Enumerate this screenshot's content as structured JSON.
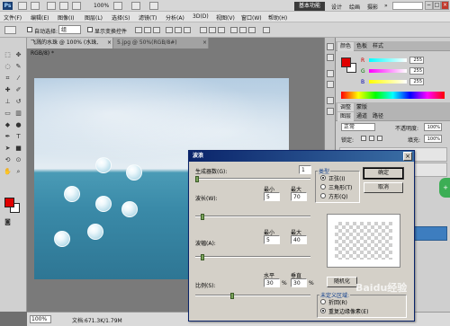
{
  "app": {
    "logo": "Ps",
    "zoom_level": "100%",
    "workspace_active": "基本功能",
    "workspaces": [
      "设计",
      "绘画",
      "摄影"
    ],
    "window_buttons": [
      "−",
      "□",
      "×"
    ]
  },
  "menu": [
    "文件(F)",
    "编辑(E)",
    "图像(I)",
    "图层(L)",
    "选择(S)",
    "滤镜(T)",
    "分析(A)",
    "3D(D)",
    "视图(V)",
    "窗口(W)",
    "帮助(H)"
  ],
  "options": {
    "auto_select_label": "自动选择:",
    "auto_select_value": "组",
    "transform_label": "显示变换控件"
  },
  "document": {
    "tab_active": "飞溅的水珠 @ 100% (水珠, RGB/8) *",
    "tab_inactive": "5.jpg @ 50%(RGB/8#)",
    "tab_close": "×"
  },
  "canvas": {
    "sky_color": "#c9dbea",
    "sea_color": "#3b8eab"
  },
  "status": {
    "zoom": "100%",
    "doc_size": "文档:671.3K/1.79M"
  },
  "panels": {
    "color_tabs": [
      "颜色",
      "色板",
      "样式"
    ],
    "color": {
      "fg": "#e00000",
      "bg": "#ffffff",
      "channels": [
        {
          "label": "R",
          "value": "255"
        },
        {
          "label": "G",
          "value": "255"
        },
        {
          "label": "B",
          "value": "255"
        }
      ]
    },
    "adjust_tabs": [
      "调整",
      "蒙版"
    ],
    "layer_tabs": [
      "图层",
      "通道",
      "路径"
    ],
    "blend_mode": "正常",
    "opacity_label": "不透明度:",
    "opacity_value": "100%",
    "lock_label": "锁定:",
    "fill_label": "填充:",
    "fill_value": "100%"
  },
  "dialog": {
    "title": "波浪",
    "close": "×",
    "generators_label": "生成器数(G):",
    "generators_value": "1",
    "min_label": "最小",
    "max_label": "最大",
    "wavelength_label": "波长(W):",
    "wavelength_min": "5",
    "wavelength_max": "70",
    "amplitude_label": "波幅(A):",
    "amplitude_min": "5",
    "amplitude_max": "40",
    "horizontal_label": "水平",
    "vertical_label": "垂直",
    "scale_label": "比例(S):",
    "scale_h": "30",
    "scale_v": "30",
    "pct": "%",
    "type_label": "类型",
    "type_options": [
      "正弦(I)",
      "三角形(T)",
      "方形(Q)"
    ],
    "ok": "确定",
    "cancel": "取消",
    "randomize": "随机化",
    "undefined_label": "未定义区域:",
    "undefined_options": [
      "折回(R)",
      "重复边缘像素(E)"
    ]
  },
  "watermark": "Baidu经验",
  "side_badge": "+"
}
